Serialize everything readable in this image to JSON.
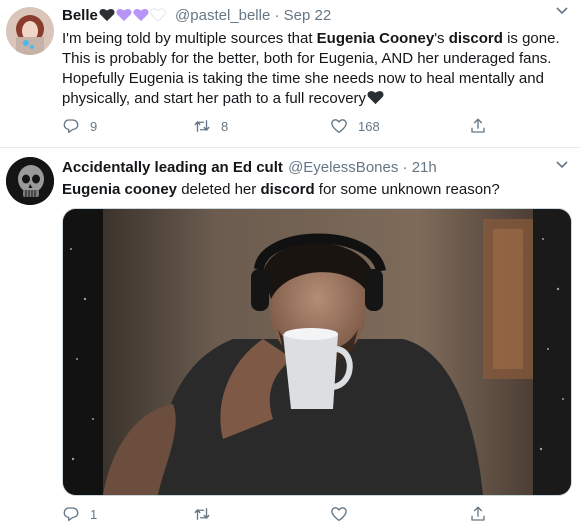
{
  "tweets": [
    {
      "display_name": "Belle",
      "handle": "@pastel_belle",
      "sep": " · ",
      "time": "Sep 22",
      "text_parts": [
        "I'm being told by multiple sources that ",
        "Eugenia Cooney",
        "'s ",
        "discord",
        " is gone. This is probably for the better, both for Eugenia, AND her underaged fans. Hopefully Eugenia is taking the time she needs now to heal mentally and physically, and start her path to a full recovery"
      ],
      "name_emoji": [
        "black-heart",
        "purple-heart",
        "purple-heart",
        "white-heart"
      ],
      "replies": "9",
      "retweets": "8",
      "likes": "168"
    },
    {
      "display_name": "Accidentally leading an Ed cult",
      "handle": "@EyelessBones",
      "sep": " · ",
      "time": "21h",
      "text_parts": [
        "Eugenia cooney",
        " deleted her ",
        "discord",
        " for some unknown reason?"
      ],
      "replies": "1",
      "retweets": "",
      "likes": ""
    }
  ],
  "colors": {
    "text": "#14171a",
    "secondary": "#657786",
    "divider": "#e6ecf0",
    "purple": "#b794f6"
  }
}
